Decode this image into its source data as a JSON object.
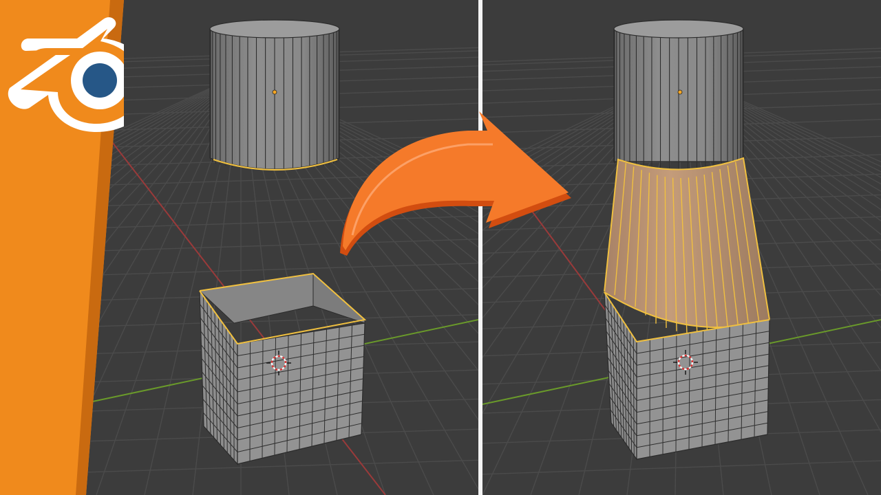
{
  "app": {
    "name": "Blender",
    "logo_icon": "blender-logo-icon"
  },
  "panels": [
    {
      "id": "before",
      "state": "separate-objects",
      "objects": [
        "cylinder-mesh",
        "open-cube-mesh"
      ]
    },
    {
      "id": "after",
      "state": "bridged-objects",
      "objects": [
        "cylinder-mesh",
        "bridge-faces",
        "open-cube-mesh"
      ]
    }
  ],
  "icons": {
    "arrow": "curved-arrow-icon",
    "origin": "object-origin-icon",
    "cursor": "3d-cursor-icon"
  },
  "colors": {
    "viewport_background": "#3c3c3c",
    "grid_line": "#4a4a4a",
    "x_axis": "#9a3a3a",
    "y_axis": "#6a9a2a",
    "mesh_face": "#8a8a8a",
    "mesh_edge": "#2a2a2a",
    "selected_edge": "#f0c040",
    "selected_face": "#c8a070",
    "accent_orange": "#f58a1f",
    "logo_blue": "#265787",
    "divider": "#f4f4f4"
  }
}
